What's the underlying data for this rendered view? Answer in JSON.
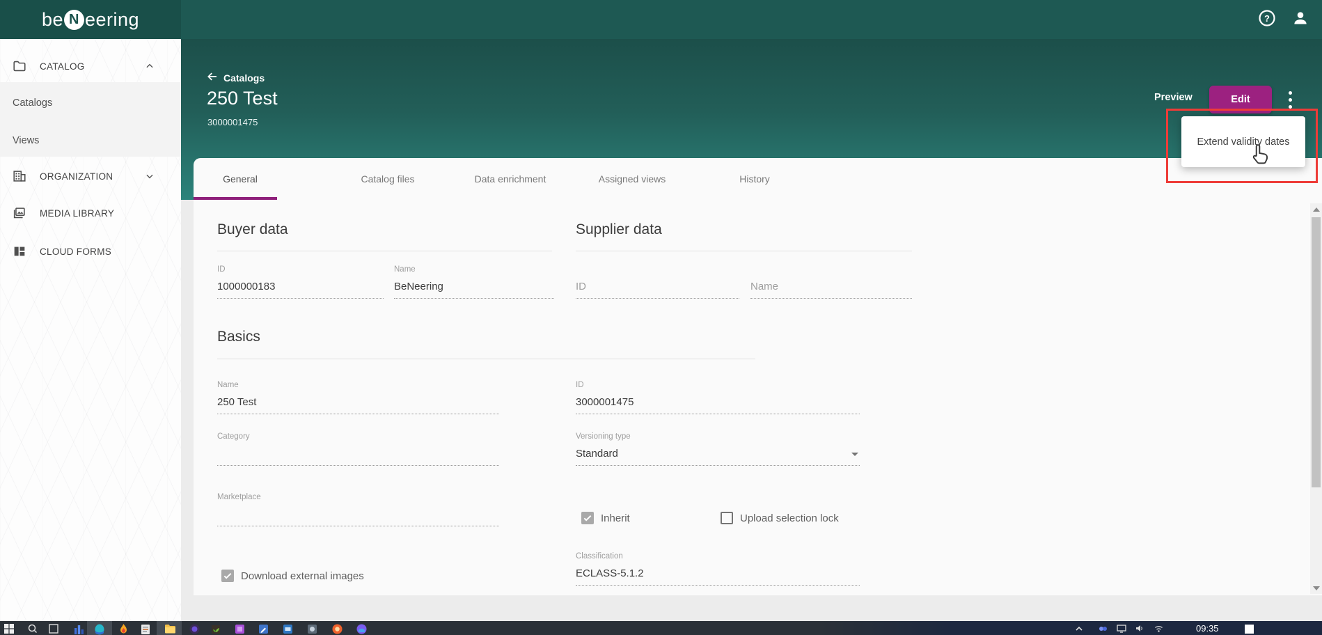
{
  "colors": {
    "topbar": "#1e5953",
    "topbar_left": "#194f49",
    "header_gradient_top": "#1c4f4a",
    "header_gradient_bottom": "#2b837b",
    "accent_magenta": "#9c2180",
    "tab_underline": "#8e1f7a",
    "annotation_red": "#ee3c38",
    "card_bg": "#fafafa"
  },
  "top_bar": {
    "logo_prefix": "be",
    "logo_n": "N",
    "logo_suffix": "eering",
    "help_icon": "help-icon",
    "user_icon": "user-icon"
  },
  "sidebar": {
    "sections": [
      {
        "label": "CATALOG",
        "icon": "folder-icon",
        "state": "expanded"
      },
      {
        "label": "ORGANIZATION",
        "icon": "building-icon",
        "state": "collapsed"
      },
      {
        "label": "MEDIA LIBRARY",
        "icon": "media-icon"
      },
      {
        "label": "CLOUD FORMS",
        "icon": "forms-icon"
      }
    ],
    "catalog_children": [
      {
        "label": "Catalogs"
      },
      {
        "label": "Views"
      }
    ]
  },
  "header": {
    "back_label": "Catalogs",
    "title": "250 Test",
    "subtitle": "3000001475",
    "preview_label": "Preview",
    "edit_label": "Edit"
  },
  "context_menu": {
    "items": [
      {
        "label": "Extend validity dates"
      }
    ]
  },
  "tabs": [
    {
      "label": "General",
      "active": true
    },
    {
      "label": "Catalog files",
      "active": false
    },
    {
      "label": "Data enrichment",
      "active": false
    },
    {
      "label": "Assigned views",
      "active": false
    },
    {
      "label": "History",
      "active": false
    }
  ],
  "form": {
    "buyer": {
      "heading": "Buyer data",
      "id_label": "ID",
      "id_value": "1000000183",
      "name_label": "Name",
      "name_value": "BeNeering"
    },
    "supplier": {
      "heading": "Supplier data",
      "id_placeholder": "ID",
      "name_placeholder": "Name"
    },
    "basics": {
      "heading": "Basics",
      "name_label": "Name",
      "name_value": "250 Test",
      "id_label": "ID",
      "id_value": "3000001475",
      "category_label": "Category",
      "category_value": "",
      "versioning_label": "Versioning type",
      "versioning_value": "Standard",
      "marketplace_label": "Marketplace",
      "marketplace_value": "",
      "inherit_label": "Inherit",
      "inherit_checked": true,
      "upload_lock_label": "Upload selection lock",
      "upload_lock_checked": false,
      "classification_label": "Classification",
      "classification_value": "ECLASS-5.1.2",
      "download_images_label": "Download external images",
      "download_images_checked": true
    }
  },
  "taskbar": {
    "time": "09:35"
  }
}
